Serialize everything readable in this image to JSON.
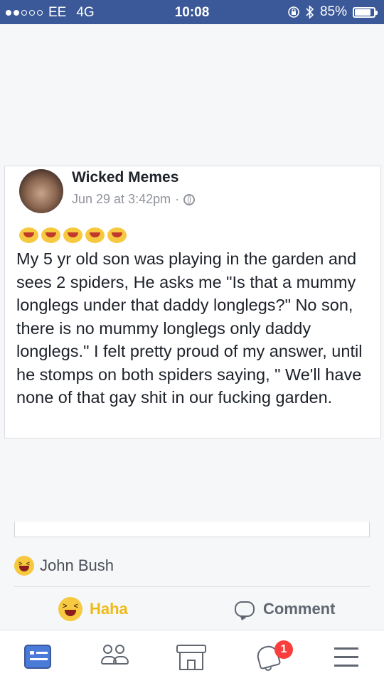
{
  "status_bar": {
    "carrier": "EE",
    "network": "4G",
    "time": "10:08",
    "battery": "85%",
    "battery_level": 0.85
  },
  "post": {
    "author": "Wicked Memes",
    "timestamp": "Jun 29 at 3:42pm",
    "separator": "·",
    "emoji_count": 5,
    "text": "My 5 yr old son was playing in the garden and sees 2 spiders, He asks me \"Is that a mummy longlegs under that daddy longlegs?\" No son, there is no mummy longlegs only daddy longlegs.\" I felt pretty proud of my answer, until he stomps on both spiders saying, \" We'll have none of that gay shit in our fucking garden."
  },
  "reactions": {
    "reactor_name": "John Bush"
  },
  "actions": {
    "haha_label": "Haha",
    "comment_label": "Comment"
  },
  "bottom_nav": {
    "notification_count": "1"
  },
  "colors": {
    "brand": "#3b5998",
    "haha": "#f0ba15",
    "badge": "#fa3e3e"
  }
}
